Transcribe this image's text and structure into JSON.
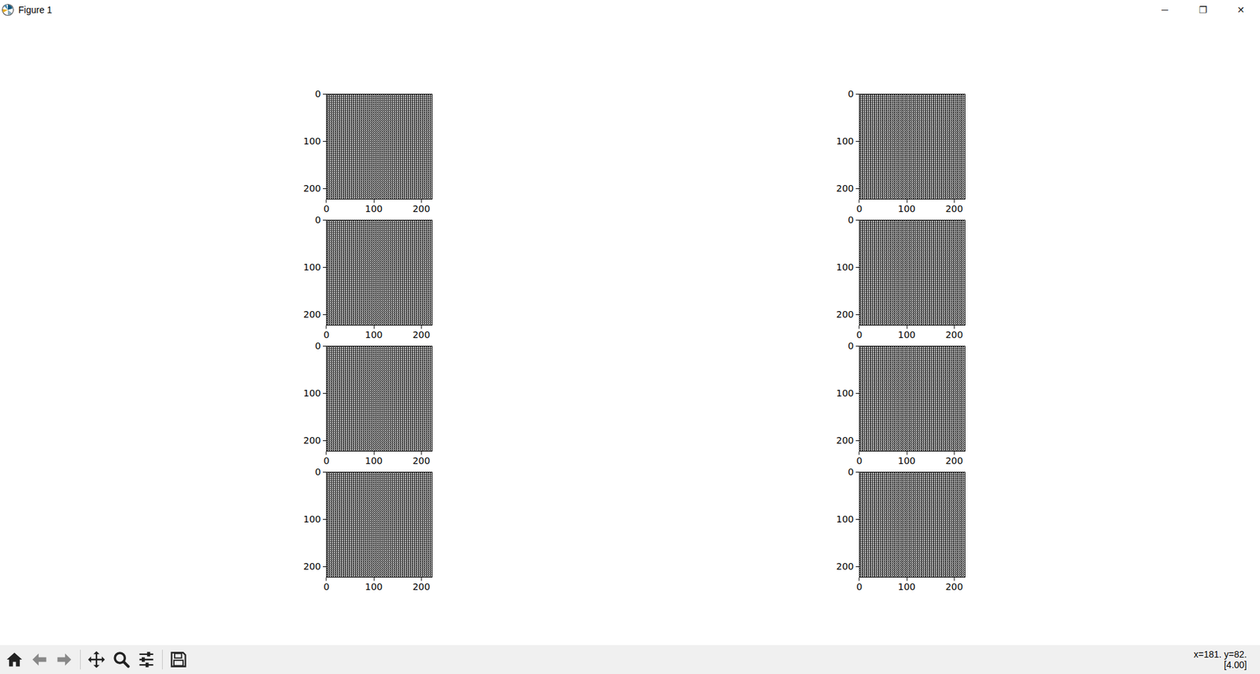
{
  "window": {
    "title": "Figure 1",
    "controls": [
      "─",
      "❐",
      "✕"
    ]
  },
  "figure": {
    "extent": 224,
    "plots": [
      {
        "xticks": [
          {
            "label": "0",
            "value": 0
          },
          {
            "label": "100",
            "value": 100
          },
          {
            "label": "200",
            "value": 200
          }
        ],
        "yticks": [
          {
            "label": "0",
            "value": 0
          },
          {
            "label": "100",
            "value": 100
          },
          {
            "label": "200",
            "value": 200
          }
        ]
      },
      {
        "xticks": [
          {
            "label": "0",
            "value": 0
          },
          {
            "label": "100",
            "value": 100
          },
          {
            "label": "200",
            "value": 200
          }
        ],
        "yticks": [
          {
            "label": "0",
            "value": 0
          },
          {
            "label": "100",
            "value": 100
          },
          {
            "label": "200",
            "value": 200
          }
        ]
      },
      {
        "xticks": [
          {
            "label": "0",
            "value": 0
          },
          {
            "label": "100",
            "value": 100
          },
          {
            "label": "200",
            "value": 200
          }
        ],
        "yticks": [
          {
            "label": "0",
            "value": 0
          },
          {
            "label": "100",
            "value": 100
          },
          {
            "label": "200",
            "value": 200
          }
        ]
      },
      {
        "xticks": [
          {
            "label": "0",
            "value": 0
          },
          {
            "label": "100",
            "value": 100
          },
          {
            "label": "200",
            "value": 200
          }
        ],
        "yticks": [
          {
            "label": "0",
            "value": 0
          },
          {
            "label": "100",
            "value": 100
          },
          {
            "label": "200",
            "value": 200
          }
        ]
      },
      {
        "xticks": [
          {
            "label": "0",
            "value": 0
          },
          {
            "label": "100",
            "value": 100
          },
          {
            "label": "200",
            "value": 200
          }
        ],
        "yticks": [
          {
            "label": "0",
            "value": 0
          },
          {
            "label": "100",
            "value": 100
          },
          {
            "label": "200",
            "value": 200
          }
        ]
      },
      {
        "xticks": [
          {
            "label": "0",
            "value": 0
          },
          {
            "label": "100",
            "value": 100
          },
          {
            "label": "200",
            "value": 200
          }
        ],
        "yticks": [
          {
            "label": "0",
            "value": 0
          },
          {
            "label": "100",
            "value": 100
          },
          {
            "label": "200",
            "value": 200
          }
        ]
      },
      {
        "xticks": [
          {
            "label": "0",
            "value": 0
          },
          {
            "label": "100",
            "value": 100
          },
          {
            "label": "200",
            "value": 200
          }
        ],
        "yticks": [
          {
            "label": "0",
            "value": 0
          },
          {
            "label": "100",
            "value": 100
          },
          {
            "label": "200",
            "value": 200
          }
        ]
      },
      {
        "xticks": [
          {
            "label": "0",
            "value": 0
          },
          {
            "label": "100",
            "value": 100
          },
          {
            "label": "200",
            "value": 200
          }
        ],
        "yticks": [
          {
            "label": "0",
            "value": 0
          },
          {
            "label": "100",
            "value": 100
          },
          {
            "label": "200",
            "value": 200
          }
        ]
      }
    ]
  },
  "status": [
    "x=181. y=82.",
    "[4.00]"
  ]
}
